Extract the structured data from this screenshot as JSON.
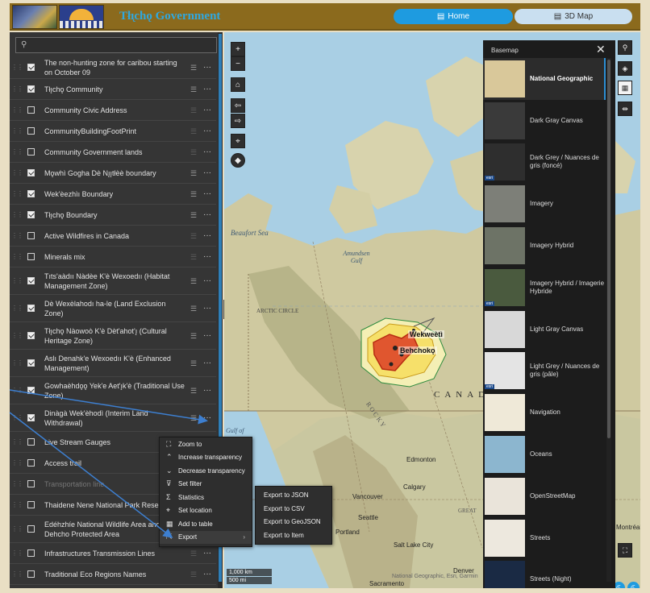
{
  "header": {
    "app_title": "Tłı̨chǫ Government",
    "home_label": "Home",
    "map3d_label": "3D Map"
  },
  "layers": [
    {
      "name": "The non-hunting zone for caribou starting on October 09",
      "checked": true,
      "dim": false
    },
    {
      "name": "Tłı̨chǫ Community",
      "checked": true,
      "dim": false
    },
    {
      "name": "Community Civic Address",
      "checked": false,
      "dim": false
    },
    {
      "name": "CommunityBuildingFootPrint",
      "checked": false,
      "dim": false
    },
    {
      "name": "Community Government lands",
      "checked": false,
      "dim": false
    },
    {
      "name": "Mǫwhì Gogha Dè Nı̨ı̨tłèè boundary",
      "checked": true,
      "dim": false
    },
    {
      "name": "Wek'èezhìı Boundary",
      "checked": true,
      "dim": false
    },
    {
      "name": "Tłı̨chǫ Boundary",
      "checked": true,
      "dim": false
    },
    {
      "name": "Active Wildfires in Canada",
      "checked": false,
      "dim": false
    },
    {
      "name": "Minerals mix",
      "checked": false,
      "dim": false
    },
    {
      "name": "Tıts'aàdıı Nàdèe K'è Wexoedıı (Habitat Management Zone)",
      "checked": true,
      "dim": false
    },
    {
      "name": "Dè Wexèlahodı ha-le (Land Exclusion Zone)",
      "checked": true,
      "dim": false
    },
    {
      "name": "Tłı̨chǫ Nàowoò K'è Dèt'ahot'ı̨ (Cultural Heritage Zone)",
      "checked": true,
      "dim": false
    },
    {
      "name": "Aslı Denahk'e Wexoedıı K'è (Enhanced Management)",
      "checked": true,
      "dim": false
    },
    {
      "name": "Gowhaèhdǫǫ Yek'e Aet'ı̨k'è (Traditional Use Zone)",
      "checked": true,
      "dim": false
    },
    {
      "name": "Dinàgà Wek'èhodì (Interim Land Withdrawal)",
      "checked": true,
      "dim": false
    },
    {
      "name": "Live Stream Gauges",
      "checked": false,
      "dim": false
    },
    {
      "name": "Access trail",
      "checked": false,
      "dim": false
    },
    {
      "name": "Transportation line",
      "checked": false,
      "dim": true
    },
    {
      "name": "Thaidene Nene National Park Reserve",
      "checked": false,
      "dim": false
    },
    {
      "name": "Edéhzhíe National Wildlife Area and Dehcho Protected Area",
      "checked": false,
      "dim": false
    },
    {
      "name": "Infrastructures Transmission Lines",
      "checked": false,
      "dim": false
    },
    {
      "name": "Traditional Eco Regions Names",
      "checked": false,
      "dim": false
    }
  ],
  "context_menu": [
    {
      "label": "Zoom to",
      "icon": "zoom-to-icon",
      "glyph": "⛶"
    },
    {
      "label": "Increase transparency",
      "icon": "chevron-up-icon",
      "glyph": "⌃"
    },
    {
      "label": "Decrease transparency",
      "icon": "chevron-down-icon",
      "glyph": "⌄"
    },
    {
      "label": "Set filter",
      "icon": "filter-icon",
      "glyph": "⊽"
    },
    {
      "label": "Statistics",
      "icon": "sigma-icon",
      "glyph": "Σ"
    },
    {
      "label": "Set location",
      "icon": "location-icon",
      "glyph": "⌖"
    },
    {
      "label": "Add to table",
      "icon": "table-icon",
      "glyph": "▦"
    },
    {
      "label": "Export",
      "icon": "export-icon",
      "glyph": "⇱"
    }
  ],
  "export_menu": [
    "Export to JSON",
    "Export to CSV",
    "Export to GeoJSON",
    "Export to Item"
  ],
  "basemap": {
    "title": "Basemap",
    "items": [
      {
        "label": "National Geographic",
        "selected": true,
        "thumb": "#d9c89a",
        "esri": false
      },
      {
        "label": "Dark Gray Canvas",
        "selected": false,
        "thumb": "#3a3a3a",
        "esri": false
      },
      {
        "label": "Dark Grey / Nuances de gris (foncé)",
        "selected": false,
        "thumb": "#2e2e2e",
        "esri": true
      },
      {
        "label": "Imagery",
        "selected": false,
        "thumb": "#7d7f78",
        "esri": false
      },
      {
        "label": "Imagery Hybrid",
        "selected": false,
        "thumb": "#6d7366",
        "esri": false
      },
      {
        "label": "Imagery Hybrid / Imagerie Hybride",
        "selected": false,
        "thumb": "#4a5a3e",
        "esri": true
      },
      {
        "label": "Light Gray Canvas",
        "selected": false,
        "thumb": "#d8d8d8",
        "esri": false
      },
      {
        "label": "Light Grey / Nuances de gris (pâle)",
        "selected": false,
        "thumb": "#e4e4e4",
        "esri": true
      },
      {
        "label": "Navigation",
        "selected": false,
        "thumb": "#efe9d8",
        "esri": false
      },
      {
        "label": "Oceans",
        "selected": false,
        "thumb": "#8cb6cf",
        "esri": false
      },
      {
        "label": "OpenStreetMap",
        "selected": false,
        "thumb": "#eae4da",
        "esri": false
      },
      {
        "label": "Streets",
        "selected": false,
        "thumb": "#ede8de",
        "esri": false
      },
      {
        "label": "Streets (Night)",
        "selected": false,
        "thumb": "#1a2a44",
        "esri": false
      }
    ]
  },
  "map": {
    "beaufort": "Beaufort Sea",
    "amundsen": "Amundsen Gulf",
    "arctic": "ARCTIC CIRCLE",
    "canada": "CANADA",
    "gulf": "Gulf of",
    "wekweeti": "Wekweètì",
    "behchoko": "Behchokǫ",
    "edmonton": "Edmonton",
    "calgary": "Calgary",
    "vancouver": "Vancouver",
    "seattle": "Seattle",
    "portland": "Portland",
    "salt_lake": "Salt Lake City",
    "denver": "Denver",
    "sacramento": "Sacramento",
    "montreal": "Montréal",
    "rocky": "R O C K Y",
    "great": "GREAT",
    "scale_km": "1,000 km",
    "scale_mi": "500 mi",
    "attribution": "National Geographic, Esri, Garmin"
  },
  "annotations_note": ""
}
